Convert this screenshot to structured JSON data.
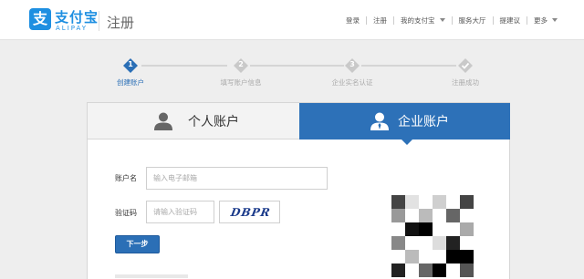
{
  "header": {
    "logo_glyph": "支",
    "logo_cn": "支付宝",
    "logo_en": "ALIPAY",
    "page_title": "注册",
    "nav": {
      "login": "登录",
      "register": "注册",
      "my_alipay": "我的支付宝",
      "service_hall": "服务大厅",
      "suggest": "提建议",
      "more": "更多"
    }
  },
  "steps": [
    {
      "num": "1",
      "label": "创建账户",
      "active": true
    },
    {
      "num": "2",
      "label": "填写账户信息",
      "active": false
    },
    {
      "num": "3",
      "label": "企业实名认证",
      "active": false
    },
    {
      "num": "",
      "label": "注册成功",
      "active": false
    }
  ],
  "tabs": {
    "personal": "个人账户",
    "business": "企业账户",
    "selected": "business"
  },
  "form": {
    "account_label": "账户名",
    "account_placeholder": "输入电子邮箱",
    "account_value": "",
    "captcha_label": "验证码",
    "captcha_placeholder": "请输入验证码",
    "captcha_value": "",
    "captcha_text": "DBPR",
    "next_button": "下一步"
  },
  "colors": {
    "brand": "#1e8fe1",
    "tab_active": "#2d71b8",
    "step_active": "#2b6fb6",
    "step_inactive": "#c9c9c9"
  }
}
